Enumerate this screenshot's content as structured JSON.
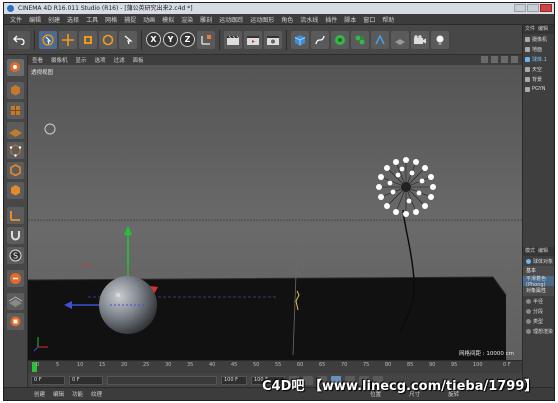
{
  "window": {
    "title": "CINEMA 4D R16.011 Studio (R16) - [蒲公英研究出来2.c4d *]"
  },
  "menubar": {
    "items": [
      "文件",
      "编辑",
      "创建",
      "选择",
      "工具",
      "网格",
      "捕捉",
      "动画",
      "模拟",
      "渲染",
      "雕刻",
      "运动跟踪",
      "运动图形",
      "角色",
      "流水线",
      "插件",
      "脚本",
      "窗口",
      "帮助"
    ]
  },
  "toolbar": {
    "axis_buttons": [
      "X",
      "Y",
      "Z"
    ]
  },
  "viewport": {
    "menu_items": [
      "查看",
      "摄像机",
      "显示",
      "选项",
      "过滤",
      "面板"
    ],
    "view_label": "透视视图",
    "grid_readout": "网格间距 : 10000 cm"
  },
  "timeline": {
    "ticks": [
      "0",
      "5",
      "10",
      "15",
      "20",
      "25",
      "30",
      "35",
      "40",
      "45",
      "50",
      "55",
      "60",
      "65",
      "70",
      "75",
      "80",
      "85",
      "90",
      "95",
      "100"
    ],
    "end_label": "0 F"
  },
  "transport": {
    "current_frame": "0 F",
    "start_frame": "0 F",
    "end_frame": "100 F",
    "end_frame2": "100 F"
  },
  "bottombar": {
    "items": [
      "创建",
      "编辑",
      "功能",
      "纹理"
    ],
    "right_items": [
      "位置",
      "尺寸",
      "旋转"
    ]
  },
  "right_panel": {
    "tabs": [
      "文件",
      "编辑"
    ],
    "objects": [
      "摄像机",
      "地面",
      "球体.1",
      "天空",
      "背景",
      "PGYN"
    ],
    "selected_index": 2,
    "attr_tabs": [
      "模式",
      "编辑"
    ],
    "attr_object": "球体对象",
    "attr_section_basic": "基本",
    "attr_mode": "平滑着色(Phong)",
    "attr_header": "对象属性",
    "attr_rows": [
      "半径",
      "分段",
      "类型",
      "理想渲染"
    ]
  },
  "watermark": "C4D吧 【www.lineсg.com/tieba/1799】",
  "colors": {
    "viewport_bg": "#5e5e5e",
    "floor": "#111111",
    "selection_blue": "#6db3ea",
    "timeline_start": "#2fbf3a"
  }
}
